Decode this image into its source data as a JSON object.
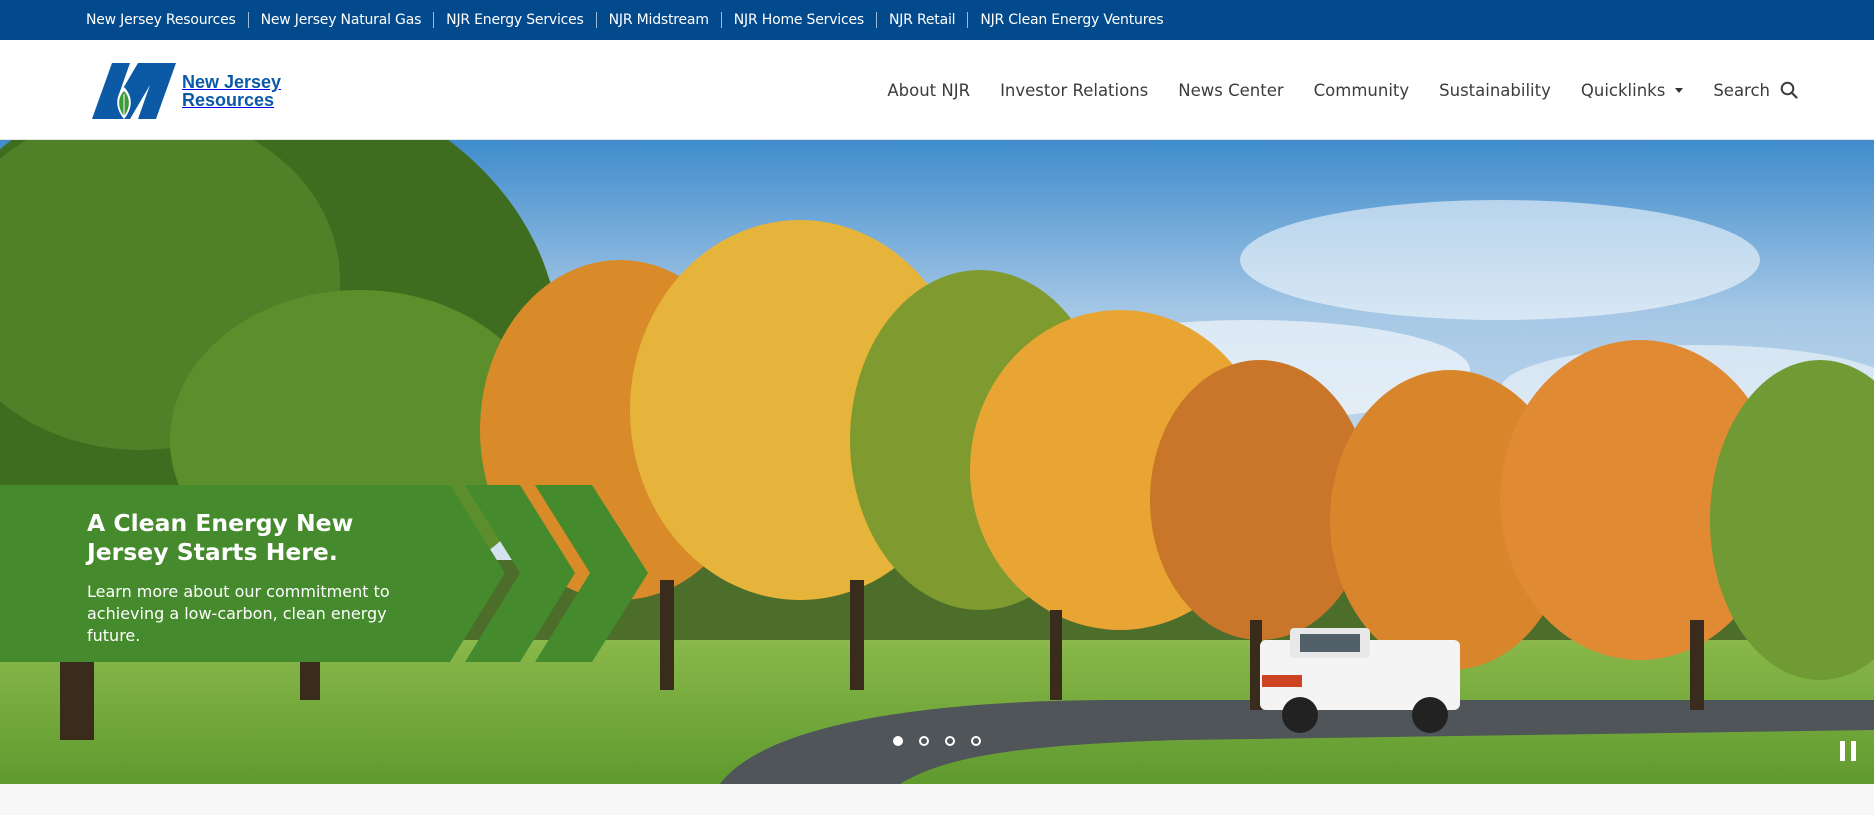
{
  "topbar": {
    "links": [
      {
        "label": "New Jersey Resources"
      },
      {
        "label": "New Jersey Natural Gas"
      },
      {
        "label": "NJR Energy Services"
      },
      {
        "label": "NJR Midstream"
      },
      {
        "label": "NJR Home Services"
      },
      {
        "label": "NJR Retail"
      },
      {
        "label": "NJR Clean Energy Ventures"
      }
    ]
  },
  "header": {
    "logo": {
      "line1": "New Jersey",
      "line2": "Resources"
    },
    "nav": {
      "about": "About NJR",
      "investor": "Investor Relations",
      "news": "News Center",
      "community": "Community",
      "sustainability": "Sustainability",
      "quicklinks": "Quicklinks",
      "search": "Search"
    }
  },
  "hero": {
    "promo": {
      "title": "A Clean Energy New Jersey Starts Here.",
      "body": "Learn more about our commitment to achieving a low-carbon, clean energy future."
    },
    "slides": {
      "count": 4,
      "active": 0
    }
  },
  "colors": {
    "topbar": "#034a8c",
    "brand_blue": "#0c5aa6",
    "promo_green": "#458a2c",
    "leaf_green": "#3d9a3a"
  },
  "icons": [
    "search-icon",
    "chevron-down-icon",
    "pause-icon",
    "njr-logo-icon"
  ]
}
